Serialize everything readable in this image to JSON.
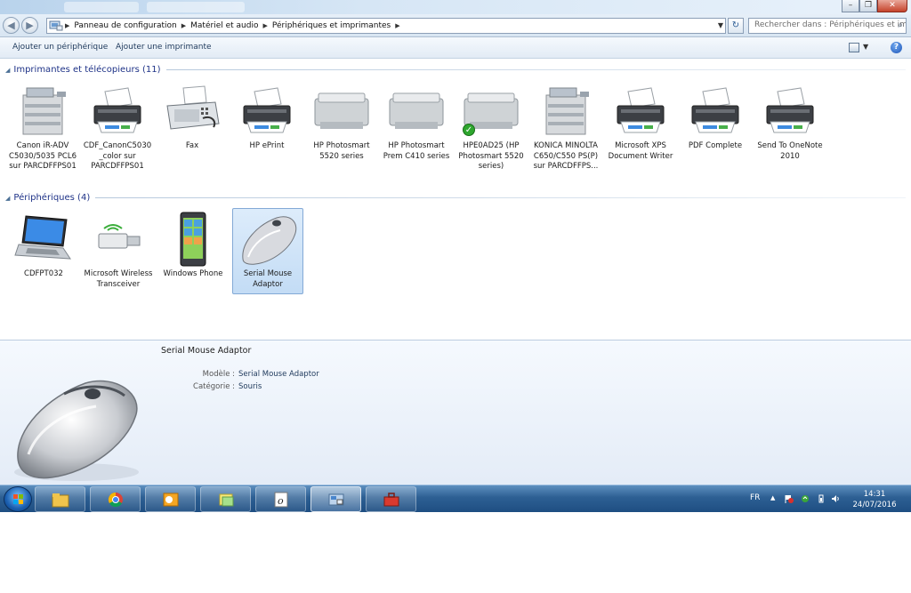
{
  "window": {
    "minimize_glyph": "–",
    "maximize_glyph": "❐",
    "close_glyph": "✕"
  },
  "nav": {
    "back_glyph": "◀",
    "forward_glyph": "▶",
    "breadcrumb": [
      "Panneau de configuration",
      "Matériel et audio",
      "Périphériques et imprimantes"
    ],
    "search_placeholder": "Rechercher dans : Périphériques et im..."
  },
  "commands": {
    "add_device": "Ajouter un périphérique",
    "add_printer": "Ajouter une imprimante"
  },
  "printers_group": {
    "title": "Imprimantes et télécopieurs (11)",
    "items": [
      {
        "label": "Canon iR-ADV C5030/5035 PCL6 sur PARCDFFPS01",
        "icon": "copier-icon"
      },
      {
        "label": "CDF_CanonC5030_color sur PARCDFFPS01",
        "icon": "printer-icon"
      },
      {
        "label": "Fax",
        "icon": "fax-icon"
      },
      {
        "label": "HP ePrint",
        "icon": "printer-icon"
      },
      {
        "label": "HP Photosmart 5520 series",
        "icon": "inkjet-printer-icon"
      },
      {
        "label": "HP Photosmart Prem C410 series",
        "icon": "inkjet-printer-icon"
      },
      {
        "label": "HPE0AD25 (HP Photosmart 5520 series)",
        "icon": "inkjet-printer-icon",
        "default": true
      },
      {
        "label": "KONICA MINOLTA C650/C550 PS(P) sur PARCDFFPS...",
        "icon": "copier-icon"
      },
      {
        "label": "Microsoft XPS Document Writer",
        "icon": "printer-icon"
      },
      {
        "label": "PDF Complete",
        "icon": "printer-icon"
      },
      {
        "label": "Send To OneNote 2010",
        "icon": "printer-icon"
      }
    ]
  },
  "devices_group": {
    "title": "Périphériques (4)",
    "items": [
      {
        "label": "CDFPT032",
        "icon": "laptop-icon"
      },
      {
        "label": "Microsoft Wireless Transceiver",
        "icon": "usb-transceiver-icon"
      },
      {
        "label": "Windows Phone",
        "icon": "phone-icon"
      },
      {
        "label": "Serial Mouse Adaptor",
        "icon": "mouse-icon",
        "selected": true
      }
    ]
  },
  "details": {
    "title": "Serial Mouse Adaptor",
    "model_label": "Modèle :",
    "model_value": "Serial Mouse Adaptor",
    "category_label": "Catégorie :",
    "category_value": "Souris"
  },
  "taskbar": {
    "apps": [
      "explorer-icon",
      "chrome-icon",
      "outlook-icon",
      "sticky-notes-icon",
      "onenote-icon",
      "devices-printers-icon",
      "toolbox-icon"
    ],
    "active_index": 5,
    "language": "FR",
    "time": "14:31",
    "date": "24/07/2016"
  },
  "colors": {
    "group_title": "#1e3287",
    "selection": "#c3dcf5",
    "taskbar": "#2d5f93"
  }
}
